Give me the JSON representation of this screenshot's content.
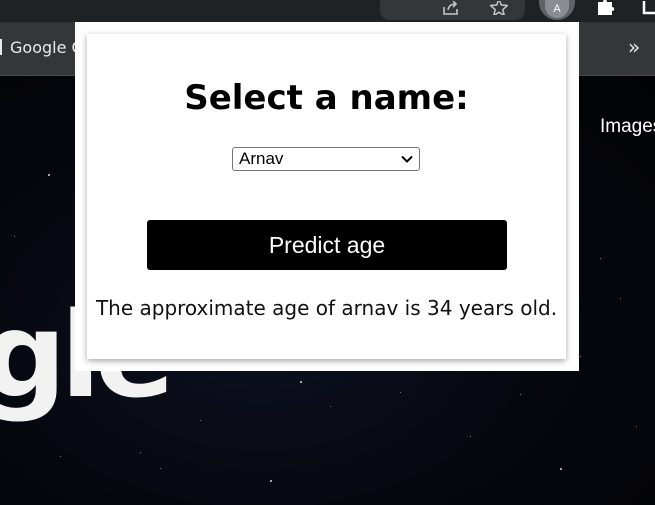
{
  "browser": {
    "bookmark_label": "Google C",
    "overflow_label": "»",
    "profile_initial": "A",
    "icons": [
      "share-icon",
      "star-icon",
      "avatar",
      "puzzle-extension-icon",
      "side-panel-icon"
    ]
  },
  "page": {
    "images_link": "Images",
    "logo_fragment": "gle"
  },
  "popup": {
    "title": "Select a name:",
    "select": {
      "selected": "Arnav"
    },
    "button_label": "Predict age",
    "result": "The approximate age of arnav is 34 years old."
  },
  "colors": {
    "toolbar_bg": "#202124",
    "bookmarks_bg": "#35363a",
    "button_bg": "#000000",
    "button_text": "#ffffff"
  }
}
